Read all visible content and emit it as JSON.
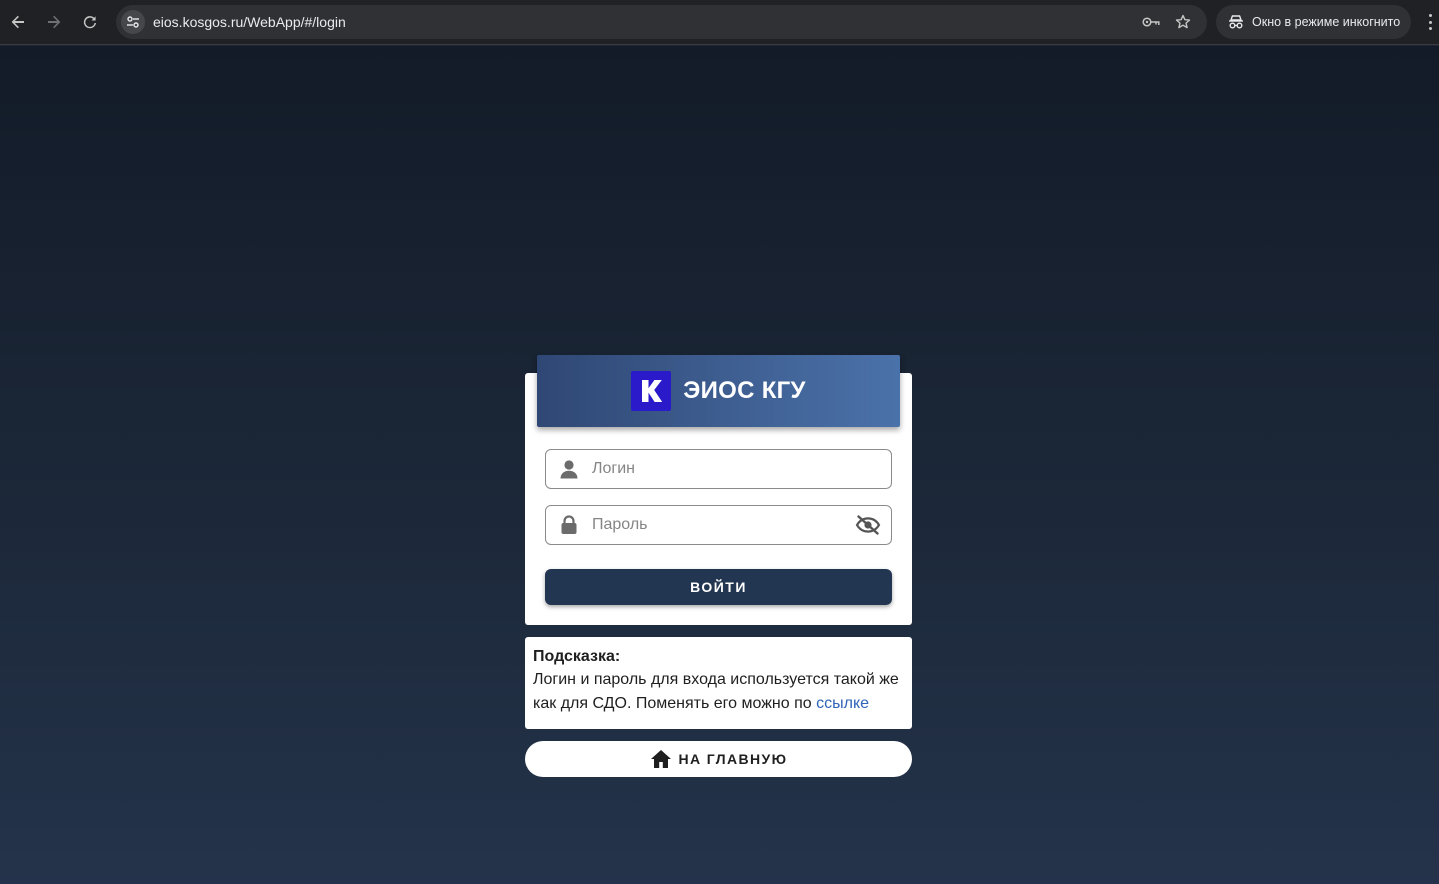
{
  "browser": {
    "url": "eios.kosgos.ru/WebApp/#/login",
    "incognito_label": "Окно в режиме инкогнито",
    "icons": [
      "back-arrow-icon",
      "forward-arrow-icon",
      "reload-icon",
      "site-settings-icon",
      "key-icon",
      "star-icon",
      "incognito-icon",
      "kebab-menu-icon"
    ]
  },
  "login_card": {
    "brand_name": "ЭИОС КГУ",
    "logo_letter": "К",
    "login_placeholder": "Логин",
    "password_placeholder": "Пароль",
    "submit_label": "ВОЙТИ"
  },
  "hint": {
    "title": "Подсказка:",
    "text": "Логин и пароль для входа используется такой же как для СДО. Поменять его можно по",
    "link_text": "ссылке"
  },
  "home_button": {
    "label": "НА ГЛАВНУЮ"
  },
  "colors": {
    "header_gradient_start": "#2f4774",
    "header_gradient_end": "#4a72aa",
    "logo_bg": "#2b1ac9",
    "button_bg": "#233651",
    "link": "#2f64b8"
  }
}
